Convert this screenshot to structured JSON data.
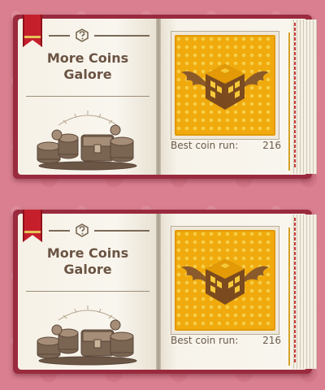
{
  "colors": {
    "background": "#d97f8f",
    "book_cover": "#9a2a3e",
    "page": "#f7f3ea",
    "ribbon": "#c51f2b",
    "title_text": "#6b5444",
    "tile_gold": "#f0aa0d",
    "wing": "#8b5a2b"
  },
  "icons": {
    "emblem": "question-block-emblem-icon",
    "coins": "coin-treasure-pile-icon",
    "block": "winged-question-block-icon"
  },
  "panels": [
    {
      "title_line1": "More Coins",
      "title_line2": "Galore",
      "stat_label": "Best coin run:",
      "stat_value": "216"
    },
    {
      "title_line1": "More Coins",
      "title_line2": "Galore",
      "stat_label": "Best coin run:",
      "stat_value": "216"
    }
  ]
}
